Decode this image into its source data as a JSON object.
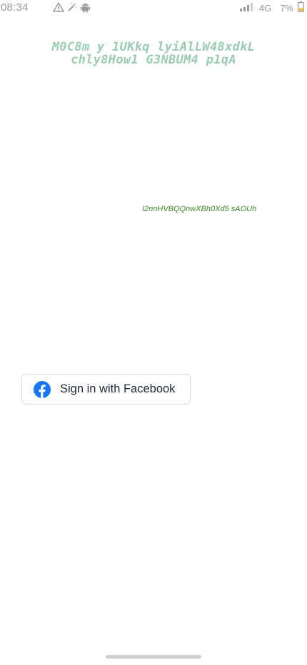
{
  "status_bar": {
    "time": "08:34",
    "network": "4G",
    "battery": "7%",
    "icons": [
      "warning-icon",
      "magic-wand-icon",
      "android-icon",
      "signal-icon",
      "battery-icon"
    ]
  },
  "title": {
    "line1": "M0C8m y 1UKkq lyiAlLW48xdkL",
    "line2": "chly8How1 G3NBUM4 p1qA",
    "color": "#9ccbb5"
  },
  "subtext": {
    "text": "I2nnHVBQQnwXBh0Xd5  sAOUh",
    "color": "#3f8a2a"
  },
  "facebook_button": {
    "label": "Sign in with Facebook",
    "icon": "facebook-icon",
    "brand_color": "#1877f2"
  }
}
